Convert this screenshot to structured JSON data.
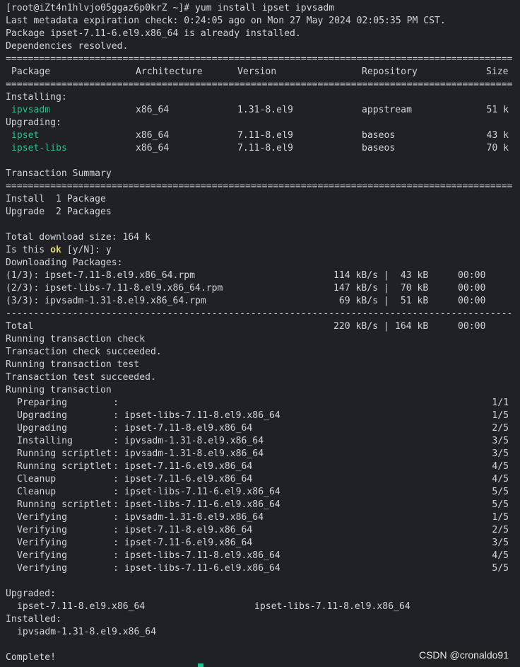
{
  "colors": {
    "background": "#1f2124",
    "text": "#d0d4d9",
    "package_highlight": "#22c08a",
    "ok_highlight": "#e0d86a"
  },
  "header": {
    "prompt": "[root@iZt4n1hlvjo05ggaz6p0krZ ~]# ",
    "command": "yum install ipset ipvsadm",
    "metadata": "Last metadata expiration check: 0:24:05 ago on Mon 27 May 2024 02:05:35 PM CST.",
    "already_installed": "Package ipset-7.11-6.el9.x86_64 is already installed.",
    "deps_resolved": "Dependencies resolved."
  },
  "separator_double": "===========================================================================================",
  "separator_dash": "-------------------------------------------------------------------------------------------",
  "table": {
    "headers": {
      "package": "Package",
      "arch": "Architecture",
      "version": "Version",
      "repo": "Repository",
      "size": "Size"
    },
    "installing_label": "Installing:",
    "upgrading_label": "Upgrading:",
    "installing": [
      {
        "package": "ipvsadm",
        "arch": "x86_64",
        "version": "1.31-8.el9",
        "repo": "appstream",
        "size": "51 k"
      }
    ],
    "upgrading": [
      {
        "package": "ipset",
        "arch": "x86_64",
        "version": "7.11-8.el9",
        "repo": "baseos",
        "size": "43 k"
      },
      {
        "package": "ipset-libs",
        "arch": "x86_64",
        "version": "7.11-8.el9",
        "repo": "baseos",
        "size": "70 k"
      }
    ]
  },
  "summary": {
    "title": "Transaction Summary",
    "install_line": "Install  1 Package",
    "upgrade_line": "Upgrade  2 Packages",
    "total_size": "Total download size: 164 k",
    "confirm_pre": "Is this ",
    "confirm_ok": "ok",
    "confirm_post": " [y/N]: y"
  },
  "downloads": {
    "title": "Downloading Packages:",
    "items": [
      {
        "name": "(1/3): ipset-7.11-8.el9.x86_64.rpm",
        "speed": "114 kB/s",
        "size": " 43 kB",
        "time": "00:00"
      },
      {
        "name": "(2/3): ipset-libs-7.11-8.el9.x86_64.rpm",
        "speed": "147 kB/s",
        "size": " 70 kB",
        "time": "00:00"
      },
      {
        "name": "(3/3): ipvsadm-1.31-8.el9.x86_64.rpm",
        "speed": " 69 kB/s",
        "size": " 51 kB",
        "time": "00:00"
      }
    ],
    "total": {
      "name": "Total",
      "speed": "220 kB/s",
      "size": "164 kB",
      "time": "00:00"
    }
  },
  "transaction": {
    "lines": [
      "Running transaction check",
      "Transaction check succeeded.",
      "Running transaction test",
      "Transaction test succeeded.",
      "Running transaction"
    ],
    "steps": [
      {
        "action": "Preparing",
        "package": "",
        "progress": "1/1"
      },
      {
        "action": "Upgrading",
        "package": "ipset-libs-7.11-8.el9.x86_64",
        "progress": "1/5"
      },
      {
        "action": "Upgrading",
        "package": "ipset-7.11-8.el9.x86_64",
        "progress": "2/5"
      },
      {
        "action": "Installing",
        "package": "ipvsadm-1.31-8.el9.x86_64",
        "progress": "3/5"
      },
      {
        "action": "Running scriptlet",
        "package": "ipvsadm-1.31-8.el9.x86_64",
        "progress": "3/5"
      },
      {
        "action": "Running scriptlet",
        "package": "ipset-7.11-6.el9.x86_64",
        "progress": "4/5"
      },
      {
        "action": "Cleanup",
        "package": "ipset-7.11-6.el9.x86_64",
        "progress": "4/5"
      },
      {
        "action": "Cleanup",
        "package": "ipset-libs-7.11-6.el9.x86_64",
        "progress": "5/5"
      },
      {
        "action": "Running scriptlet",
        "package": "ipset-libs-7.11-6.el9.x86_64",
        "progress": "5/5"
      },
      {
        "action": "Verifying",
        "package": "ipvsadm-1.31-8.el9.x86_64",
        "progress": "1/5"
      },
      {
        "action": "Verifying",
        "package": "ipset-7.11-8.el9.x86_64",
        "progress": "2/5"
      },
      {
        "action": "Verifying",
        "package": "ipset-7.11-6.el9.x86_64",
        "progress": "3/5"
      },
      {
        "action": "Verifying",
        "package": "ipset-libs-7.11-8.el9.x86_64",
        "progress": "4/5"
      },
      {
        "action": "Verifying",
        "package": "ipset-libs-7.11-6.el9.x86_64",
        "progress": "5/5"
      }
    ]
  },
  "result": {
    "upgraded_label": "Upgraded:",
    "upgraded": [
      "ipset-7.11-8.el9.x86_64",
      "ipset-libs-7.11-8.el9.x86_64"
    ],
    "installed_label": "Installed:",
    "installed": [
      "ipvsadm-1.31-8.el9.x86_64"
    ],
    "complete": "Complete!"
  },
  "watermark": "CSDN @cronaldo91"
}
